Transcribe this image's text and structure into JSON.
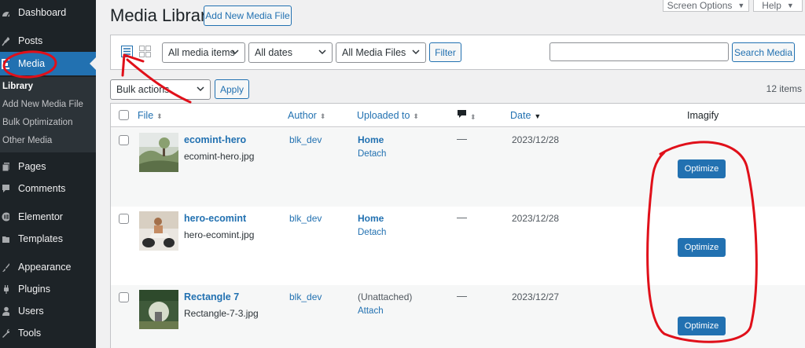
{
  "sidebar": {
    "items": [
      {
        "label": "Dashboard",
        "icon": "dashboard-icon"
      },
      {
        "label": "Posts",
        "icon": "pin-icon"
      },
      {
        "label": "Media",
        "icon": "media-icon",
        "active": true
      },
      {
        "label": "Pages",
        "icon": "pages-icon"
      },
      {
        "label": "Comments",
        "icon": "comment-icon"
      },
      {
        "label": "Elementor",
        "icon": "elementor-icon"
      },
      {
        "label": "Templates",
        "icon": "folder-icon"
      },
      {
        "label": "Appearance",
        "icon": "brush-icon"
      },
      {
        "label": "Plugins",
        "icon": "plug-icon"
      },
      {
        "label": "Users",
        "icon": "user-icon"
      },
      {
        "label": "Tools",
        "icon": "wrench-icon"
      }
    ],
    "submenu": [
      "Library",
      "Add New Media File",
      "Bulk Optimization",
      "Other Media"
    ]
  },
  "header": {
    "title": "Media Library",
    "add_new_label": "Add New Media File",
    "screen_options_label": "Screen Options",
    "help_label": "Help"
  },
  "filters": {
    "media_type": "All media items",
    "dates": "All dates",
    "files": "All Media Files",
    "filter_label": "Filter",
    "search_value": "",
    "search_button": "Search Media"
  },
  "bulk": {
    "selected": "Bulk actions",
    "apply_label": "Apply",
    "items_count": "12 items"
  },
  "table": {
    "columns": [
      "File",
      "Author",
      "Uploaded to",
      "Date",
      "Imagify"
    ],
    "rows": [
      {
        "title": "ecomint-hero",
        "file": "ecomint-hero.jpg",
        "author": "blk_dev",
        "uploaded_to": "Home",
        "action": "Detach",
        "comments": "—",
        "date": "2023/12/28",
        "imagify": "Optimize"
      },
      {
        "title": "hero-ecomint",
        "file": "hero-ecomint.jpg",
        "author": "blk_dev",
        "uploaded_to": "Home",
        "action": "Detach",
        "comments": "—",
        "date": "2023/12/28",
        "imagify": "Optimize"
      },
      {
        "title": "Rectangle 7",
        "file": "Rectangle-7-3.jpg",
        "author": "blk_dev",
        "uploaded_to": "(Unattached)",
        "action": "Attach",
        "comments": "—",
        "date": "2023/12/27",
        "imagify": "Optimize"
      }
    ]
  },
  "colors": {
    "sidebar_bg": "#1d2327",
    "accent": "#2271b1",
    "annotation": "#e0101a"
  }
}
